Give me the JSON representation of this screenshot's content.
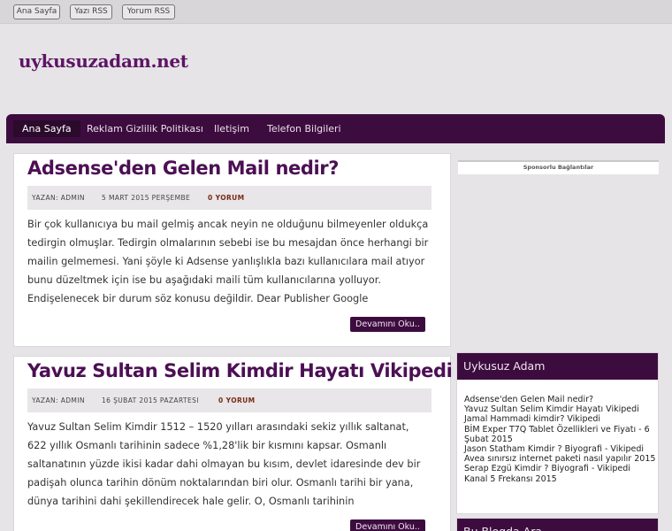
{
  "topbar": {
    "links": [
      "Ana Sayfa",
      "Yazı RSS",
      "Yorum RSS"
    ]
  },
  "site": {
    "title": "uykusuzadam.net"
  },
  "nav": {
    "items": [
      "Ana Sayfa",
      "Reklam Gizlilik Politikası",
      "Iletişim",
      "Telefon Bilgileri"
    ]
  },
  "posts": [
    {
      "title": "Adsense'den Gelen Mail nedir?",
      "author": "YAZAN: ADMIN",
      "date": "5 MART 2015 PERŞEMBE",
      "comments": "0 YORUM",
      "excerpt": "Bir çok kullanıcıya bu mail gelmiş ancak neyin ne olduğunu bilmeyenler oldukça tedirgin olmuşlar. Tedirgin olmalarının sebebi ise bu mesajdan önce herhangi bir mailin gelmemesi. Yani şöyle ki Adsense yanlışlıkla bazı kullanıcılara mail atıyor bunu düzeltmek için ise bu aşağıdaki maili tüm kullanıcılarına yolluyor. Endişelenecek bir durum söz konusu değildir. Dear Publisher Google",
      "more": "Devamını Oku.."
    },
    {
      "title": "Yavuz Sultan Selim Kimdir Hayatı Vikipedi",
      "author": "YAZAN: ADMIN",
      "date": "16 ŞUBAT 2015 PAZARTESI",
      "comments": "0 YORUM",
      "excerpt": "Yavuz Sultan Selim Kimdir 1512 – 1520 yılları arasındaki sekiz yıllık saltanat, 622 yıllık Osmanlı tarihinin sadece %1,28'lik bir kısmını kapsar. Osmanlı saltanatının yüzde ikisi kadar dahi olmayan bu kısım, devlet idaresinde dev bir padişah olunca tarihin dönüm noktalarından biri olur. Osmanlı tarihi bir yana, dünya tarihini dahi şekillendirecek hale gelir. O, Osmanlı tarihinin",
      "more": "Devamını Oku.."
    }
  ],
  "sidebar": {
    "sponsor": "Sponsorlu Bağlantılar",
    "recent_title": "Uykusuz Adam",
    "recent": [
      "Adsense'den Gelen Mail nedir?",
      "Yavuz Sultan Selim Kimdir Hayatı Vikipedi",
      "Jamal Hammadi kimdir? Vikipedi",
      "BİM Exper T7Q Tablet Özellikleri ve Fiyatı - 6 Şubat 2015",
      "Jason Statham Kimdir ? Biyografi - Vikipedi",
      "Avea sınırsız internet paketi nasıl yapılır 2015",
      "Serap Ezgü Kimdir ? Biyografi - Vikipedi",
      "Kanal 5 Frekansı 2015"
    ],
    "search_title": "Bu Blogda Ara"
  }
}
